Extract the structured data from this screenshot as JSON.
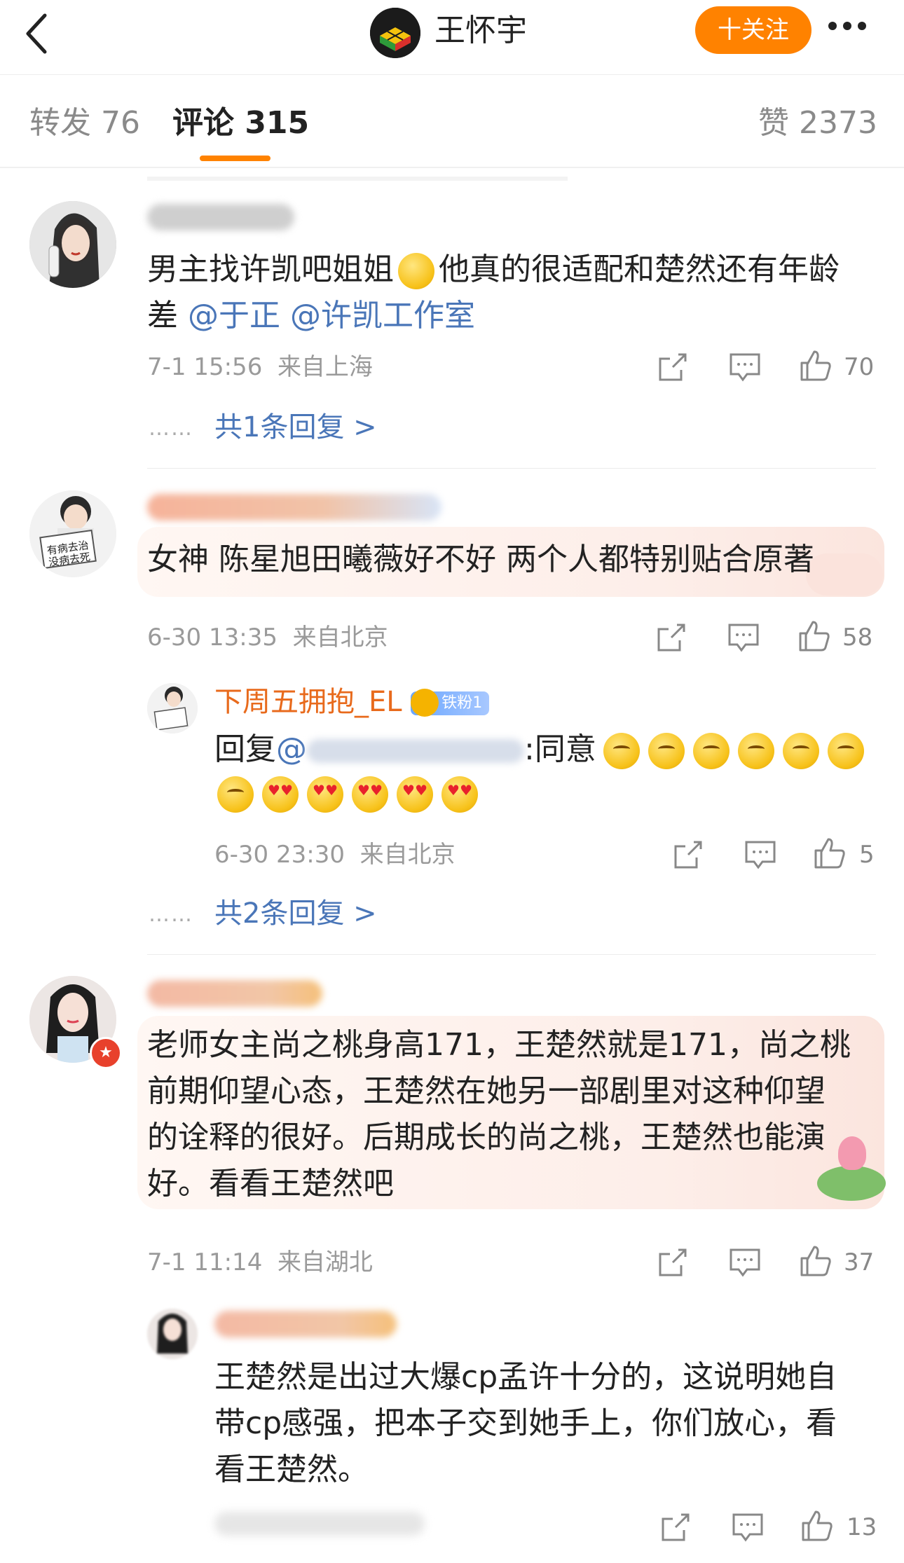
{
  "header": {
    "profile_name": "王怀宇",
    "follow_label": "十关注"
  },
  "tabs": [
    {
      "label": "转发 76"
    },
    {
      "label": "评论 315"
    },
    {
      "label": "赞 2373"
    }
  ],
  "comments": [
    {
      "text_line1": "男主找许凯吧姐姐",
      "text_line1b": "他真的很适配和楚然还有年龄",
      "text_line2_prefix": "差 ",
      "mention1": "@于正",
      "mention2": "@许凯工作室",
      "time_loc": "7-1 15:56  来自上海",
      "likes": "70",
      "reply_link": "共1条回复 >",
      "dots": "……"
    },
    {
      "text": "女神 陈星旭田曦薇好不好 两个人都特别贴合原著",
      "time_loc": "6-30 13:35  来自北京",
      "likes": "58",
      "avatar_sign_line1": "有病去治",
      "avatar_sign_line2": "没病去死",
      "reply": {
        "username": "下周五拥抱_EL",
        "badge": "铁粉1",
        "reply_prefix": "回复",
        "reply_mention": "@",
        "reply_text": ":同意",
        "time_loc": "6-30 23:30  来自北京",
        "likes": "5"
      },
      "reply_link": "共2条回复 >",
      "dots": "……"
    },
    {
      "lines": [
        "老师女主尚之桃身高171，王楚然就是171，尚之桃",
        "前期仰望心态，王楚然在她另一部剧里对这种仰望",
        "的诠释的很好。后期成长的尚之桃，王楚然也能演",
        "好。看看王楚然吧"
      ],
      "time_loc": "7-1 11:14  来自湖北",
      "likes": "37",
      "reply": {
        "lines": [
          "王楚然是出过大爆cp孟许十分的，这说明她自",
          "带cp感强，把本子交到她手上，你们放心，看",
          "看王楚然。"
        ],
        "likes": "13"
      }
    }
  ]
}
